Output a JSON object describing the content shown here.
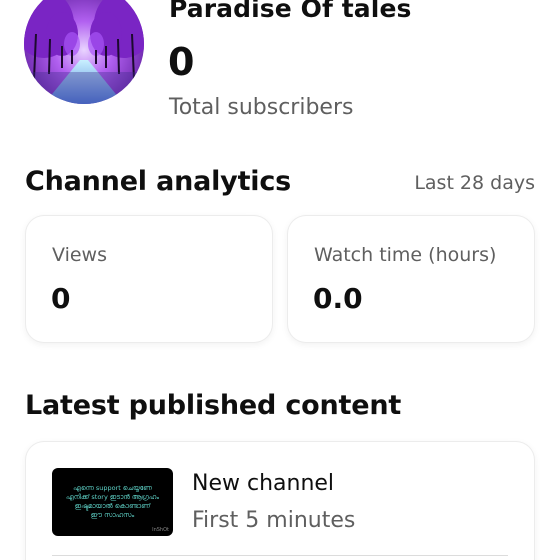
{
  "channel": {
    "name": "Paradise Of tales",
    "subscriber_count": "0",
    "subscriber_label": "Total subscribers"
  },
  "analytics": {
    "title": "Channel analytics",
    "period": "Last 28 days",
    "views": {
      "label": "Views",
      "value": "0"
    },
    "watch_time": {
      "label": "Watch time (hours)",
      "value": "0.0"
    }
  },
  "latest": {
    "title": "Latest published content",
    "video": {
      "title": "New channel",
      "meta": "First 5 minutes",
      "thumbnail_lines": [
        "എന്നെ support ചെയ്യണേ",
        "എനിക്ക് story ഇടാൻ ആഗ്രഹം",
        "ഇഷ്ടമായാൽ കൊണ്ടാണ്",
        "ഈ സാഹസം"
      ],
      "thumbnail_mark": "InShOt"
    }
  },
  "colors": {
    "text_primary": "#0f0f0f",
    "text_secondary": "#5f5f5f",
    "thumbnail_text": "#5fd3c8",
    "avatar_purple": "#8a2fd6"
  }
}
